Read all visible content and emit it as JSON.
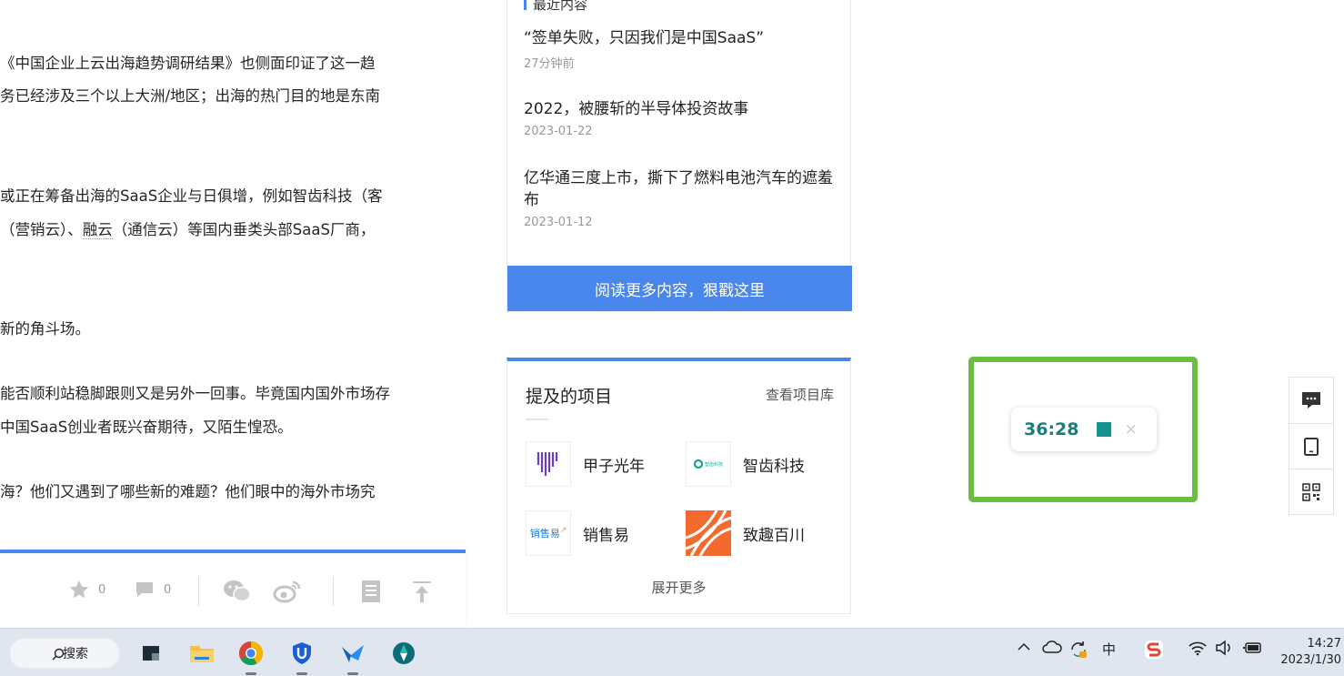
{
  "article": {
    "p1_line1": "《中国企业上云出海趋势调研结果》也侧面印证了这一趋",
    "p1_line2": "务已经涉及三个以上大洲/地区；出海的热门目的地是东南",
    "p2_line1": "或正在筹备出海的SaaS企业与日俱增，例如智齿科技（客",
    "p2_line2_a": "（营销云）、",
    "p2_line2_link": "融云",
    "p2_line2_b": "（通信云）等国内垂类头部SaaS厂商，",
    "p3_line1": "新的角斗场。",
    "p4_line1": "能否顺利站稳脚跟则又是另外一回事。毕竟国内国外市场存",
    "p4_line2": "中国SaaS创业者既兴奋期待，又陌生惶恐。",
    "p5_line1": "海？他们又遇到了哪些新的难题？他们眼中的海外市场究"
  },
  "share_bar": {
    "star_count": "0",
    "comment_count": "0",
    "icons": [
      "star-icon",
      "comment-icon",
      "wechat-icon",
      "weibo-icon",
      "article-icon",
      "back-to-top-icon"
    ]
  },
  "recent": {
    "title": "最近内容",
    "items": [
      {
        "title": "“签单失败，只因我们是中国SaaS”",
        "date": "27分钟前"
      },
      {
        "title": "2022，被腰斩的半导体投资故事",
        "date": "2023-01-22"
      },
      {
        "title": "亿华通三度上市，撕下了燃料电池汽车的遮羞布",
        "date": "2023-01-12"
      }
    ],
    "more_button": "阅读更多内容，狠戳这里"
  },
  "projects": {
    "title": "提及的项目",
    "library_link": "查看项目库",
    "items": [
      {
        "name": "甲子光年",
        "logo_text": ""
      },
      {
        "name": "智齿科技",
        "logo_text": "智齿科技"
      },
      {
        "name": "销售易",
        "logo_text": "销售易"
      },
      {
        "name": "致趣百川",
        "logo_text": ""
      }
    ],
    "expand": "展开更多"
  },
  "timer": {
    "time": "36:28",
    "close": "×"
  },
  "side_tools": [
    "comment-icon",
    "tablet-icon",
    "qrcode-icon"
  ],
  "taskbar": {
    "search_label": "搜索",
    "apps": [
      "desktop-icon",
      "file-explorer-icon",
      "chrome-icon",
      "app-shield-icon",
      "app-bird-icon",
      "app-compass-icon"
    ],
    "tray": {
      "ime": "中",
      "clock_time": "14:27",
      "clock_date": "2023/1/30"
    }
  },
  "colors": {
    "accent": "#4a87ec",
    "timer_text": "#187d7b",
    "highlight_border": "#6bbd44",
    "taskbar": "#dfe6f0"
  }
}
